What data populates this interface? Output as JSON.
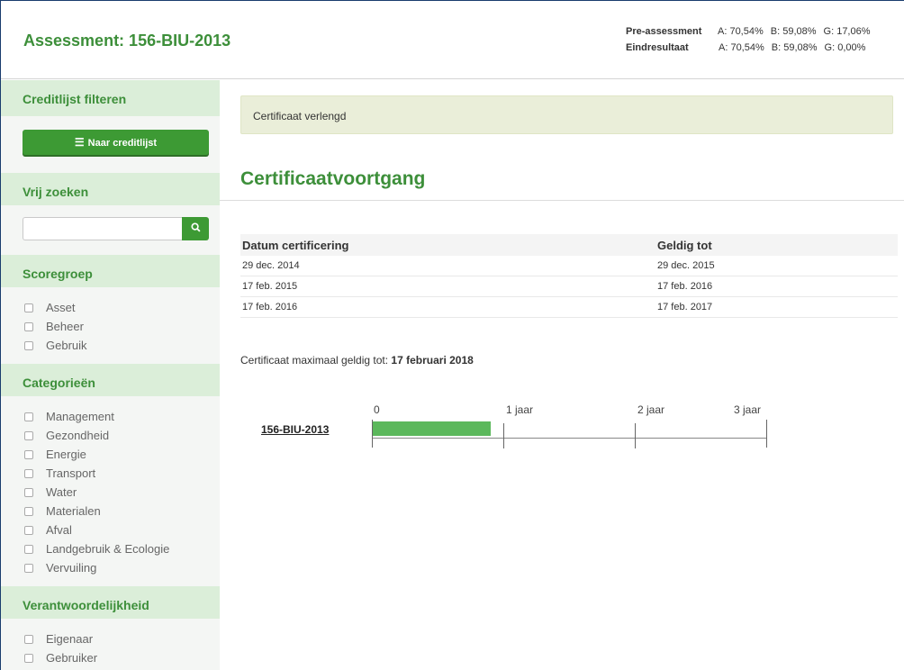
{
  "header": {
    "title": "Assessment: 156-BIU-2013",
    "scores": [
      {
        "label": "Pre-assessment",
        "a": "A: 70,54%",
        "b": "B: 59,08%",
        "g": "G: 17,06%"
      },
      {
        "label": "Eindresultaat",
        "a": "A: 70,54%",
        "b": "B: 59,08%",
        "g": "G: 0,00%"
      }
    ]
  },
  "sidebar": {
    "filter_title": "Creditlijst filteren",
    "to_list_button": "Naar creditlijst",
    "search_title": "Vrij zoeken",
    "search_placeholder": "",
    "scoregroep_title": "Scoregroep",
    "scoregroep": [
      "Asset",
      "Beheer",
      "Gebruik"
    ],
    "categorieen_title": "Categorieën",
    "categorieen": [
      "Management",
      "Gezondheid",
      "Energie",
      "Transport",
      "Water",
      "Materialen",
      "Afval",
      "Landgebruik & Ecologie",
      "Vervuiling"
    ],
    "verantwoordelijkheid_title": "Verantwoordelijkheid",
    "verantwoordelijkheid": [
      "Eigenaar",
      "Gebruiker"
    ]
  },
  "main": {
    "alert": "Certificaat verlengd",
    "page_title": "Certificaatvoortgang",
    "table": {
      "headers": [
        "Datum certificering",
        "Geldig tot"
      ],
      "rows": [
        [
          "29 dec. 2014",
          "29 dec. 2015"
        ],
        [
          "17 feb. 2015",
          "17 feb. 2016"
        ],
        [
          "17 feb. 2016",
          "17 feb. 2017"
        ]
      ]
    },
    "max_valid_label": "Certificaat maximaal geldig tot:",
    "max_valid_value": "17 februari 2018",
    "timeline": {
      "label": "156-BIU-2013",
      "ticks": [
        "0",
        "1 jaar",
        "2 jaar",
        "3 jaar"
      ],
      "progress_years": 0.9,
      "max_years": 3,
      "bar_color": "#5cb85c"
    }
  },
  "colors": {
    "accent_green": "#3d8f3a",
    "button_green": "#3d9a34",
    "sidebar_head_bg": "#dbeed9"
  }
}
